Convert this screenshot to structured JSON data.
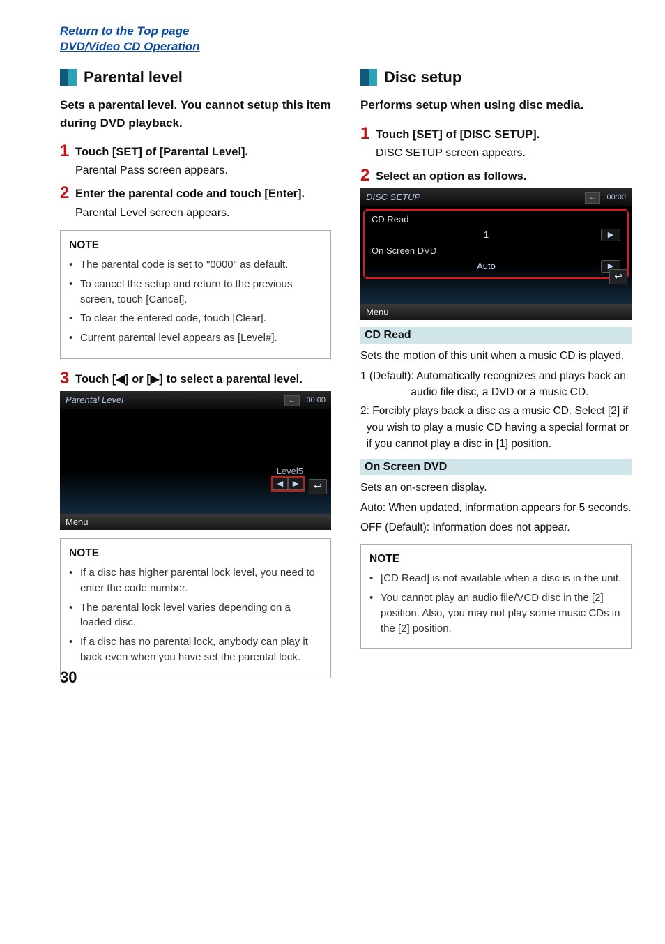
{
  "top_links": {
    "return": "Return to the Top page",
    "section": "DVD/Video CD Operation"
  },
  "left": {
    "heading": "Parental level",
    "intro": "Sets a parental level. You cannot setup this item during DVD playback.",
    "steps": [
      {
        "title": "Touch [SET] of [Parental Level].",
        "desc": "Parental Pass screen appears."
      },
      {
        "title": "Enter the parental code and touch [Enter].",
        "desc": "Parental Level screen appears."
      }
    ],
    "note1": {
      "title": "NOTE",
      "items": [
        "The parental code is set to \"0000\" as default.",
        "To cancel the setup and return to the previous screen, touch [Cancel].",
        "To clear the entered code, touch [Clear].",
        "Current parental level appears as [Level#]."
      ]
    },
    "step3": "Touch [◀] or [▶] to select a parental level.",
    "screenshot": {
      "title": "Parental Level",
      "time": "00:00",
      "level": "Level5",
      "menu": "Menu"
    },
    "note2": {
      "title": "NOTE",
      "items": [
        "If a disc has higher parental lock level, you need to enter the code number.",
        "The parental lock level varies depending on a loaded disc.",
        "If a disc has no parental lock, anybody can play it back even when you have set the parental lock."
      ]
    }
  },
  "right": {
    "heading": "Disc setup",
    "intro": "Performs setup when using disc media.",
    "steps": [
      {
        "title": "Touch [SET] of [DISC SETUP].",
        "desc": "DISC SETUP screen appears."
      }
    ],
    "step2": "Select an option as follows.",
    "screenshot": {
      "title": "DISC SETUP",
      "time": "00:00",
      "row1": {
        "label": "CD Read",
        "value": "1"
      },
      "row2": {
        "label": "On Screen DVD",
        "value": "Auto"
      },
      "menu": "Menu"
    },
    "cd_read": {
      "heading": "CD Read",
      "desc": "Sets the motion of this unit when a music CD is played.",
      "opts": [
        {
          "key": "1 (Default)",
          "val": ": Automatically recognizes and plays back an audio file disc, a DVD or a music CD."
        },
        {
          "key": "2",
          "val": ": Forcibly plays back a disc as a music CD. Select [2] if you wish to play a music CD having a special format or if you cannot play a disc in [1] position."
        }
      ]
    },
    "osd": {
      "heading": "On Screen DVD",
      "desc": "Sets an on-screen display.",
      "opts": [
        {
          "key": "Auto",
          "val": ": When updated, information appears for 5 seconds."
        },
        {
          "key": "OFF (Default)",
          "val": ": Information does not appear."
        }
      ]
    },
    "note": {
      "title": "NOTE",
      "items": [
        "[CD Read] is not available when a disc is in the unit.",
        "You cannot play an audio file/VCD disc in the [2] position. Also, you may not play some music CDs in the [2] position."
      ]
    }
  },
  "page_number": "30"
}
